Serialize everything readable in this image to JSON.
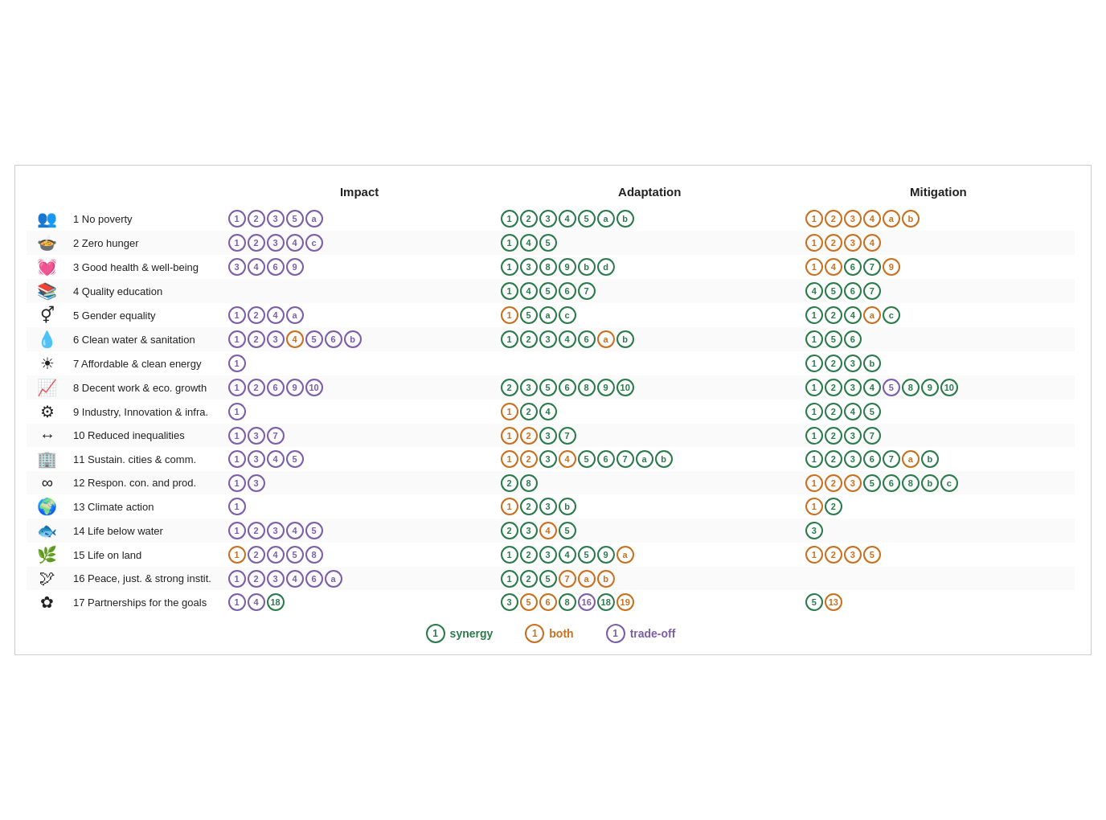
{
  "headers": {
    "icon": "",
    "sdg": "",
    "impact": "Impact",
    "adaptation": "Adaptation",
    "mitigation": "Mitigation"
  },
  "rows": [
    {
      "id": 1,
      "icon": "👨‍👩‍👧‍👦",
      "label": "1 No poverty",
      "impact": [
        {
          "v": "1",
          "t": "purple"
        },
        {
          "v": "2",
          "t": "purple"
        },
        {
          "v": "3",
          "t": "purple"
        },
        {
          "v": "5",
          "t": "purple"
        },
        {
          "v": "a",
          "t": "purple"
        }
      ],
      "adaptation": [
        {
          "v": "1",
          "t": "green"
        },
        {
          "v": "2",
          "t": "green"
        },
        {
          "v": "3",
          "t": "green"
        },
        {
          "v": "4",
          "t": "green"
        },
        {
          "v": "5",
          "t": "green"
        },
        {
          "v": "a",
          "t": "green"
        },
        {
          "v": "b",
          "t": "green"
        }
      ],
      "mitigation": [
        {
          "v": "1",
          "t": "orange"
        },
        {
          "v": "2",
          "t": "orange"
        },
        {
          "v": "3",
          "t": "orange"
        },
        {
          "v": "4",
          "t": "orange"
        },
        {
          "v": "a",
          "t": "orange"
        },
        {
          "v": "b",
          "t": "orange"
        }
      ]
    },
    {
      "id": 2,
      "icon": "🍚",
      "label": "2 Zero hunger",
      "impact": [
        {
          "v": "1",
          "t": "purple"
        },
        {
          "v": "2",
          "t": "purple"
        },
        {
          "v": "3",
          "t": "purple"
        },
        {
          "v": "4",
          "t": "purple"
        },
        {
          "v": "c",
          "t": "purple"
        }
      ],
      "adaptation": [
        {
          "v": "1",
          "t": "green"
        },
        {
          "v": "4",
          "t": "green"
        },
        {
          "v": "5",
          "t": "green"
        }
      ],
      "mitigation": [
        {
          "v": "1",
          "t": "orange"
        },
        {
          "v": "2",
          "t": "orange"
        },
        {
          "v": "3",
          "t": "orange"
        },
        {
          "v": "4",
          "t": "orange"
        }
      ]
    },
    {
      "id": 3,
      "icon": "💓",
      "label": "3 Good health & well-being",
      "impact": [
        {
          "v": "3",
          "t": "purple"
        },
        {
          "v": "4",
          "t": "purple"
        },
        {
          "v": "6",
          "t": "purple"
        },
        {
          "v": "9",
          "t": "purple"
        }
      ],
      "adaptation": [
        {
          "v": "1",
          "t": "green"
        },
        {
          "v": "3",
          "t": "green"
        },
        {
          "v": "8",
          "t": "green"
        },
        {
          "v": "9",
          "t": "green"
        },
        {
          "v": "b",
          "t": "green"
        },
        {
          "v": "d",
          "t": "green"
        }
      ],
      "mitigation": [
        {
          "v": "1",
          "t": "orange"
        },
        {
          "v": "4",
          "t": "orange"
        },
        {
          "v": "6",
          "t": "green"
        },
        {
          "v": "7",
          "t": "green"
        },
        {
          "v": "9",
          "t": "orange"
        }
      ]
    },
    {
      "id": 4,
      "icon": "📖",
      "label": "4 Quality education",
      "impact": [],
      "adaptation": [
        {
          "v": "1",
          "t": "green"
        },
        {
          "v": "4",
          "t": "green"
        },
        {
          "v": "5",
          "t": "green"
        },
        {
          "v": "6",
          "t": "green"
        },
        {
          "v": "7",
          "t": "green"
        }
      ],
      "mitigation": [
        {
          "v": "4",
          "t": "green"
        },
        {
          "v": "5",
          "t": "green"
        },
        {
          "v": "6",
          "t": "green"
        },
        {
          "v": "7",
          "t": "green"
        }
      ]
    },
    {
      "id": 5,
      "icon": "⚧",
      "label": "5 Gender equality",
      "impact": [
        {
          "v": "1",
          "t": "purple"
        },
        {
          "v": "2",
          "t": "purple"
        },
        {
          "v": "4",
          "t": "purple"
        },
        {
          "v": "a",
          "t": "purple"
        }
      ],
      "adaptation": [
        {
          "v": "1",
          "t": "orange"
        },
        {
          "v": "5",
          "t": "green"
        },
        {
          "v": "a",
          "t": "green"
        },
        {
          "v": "c",
          "t": "green"
        }
      ],
      "mitigation": [
        {
          "v": "1",
          "t": "green"
        },
        {
          "v": "2",
          "t": "green"
        },
        {
          "v": "4",
          "t": "green"
        },
        {
          "v": "a",
          "t": "orange"
        },
        {
          "v": "c",
          "t": "green"
        }
      ]
    },
    {
      "id": 6,
      "icon": "💧",
      "label": "6 Clean water & sanitation",
      "impact": [
        {
          "v": "1",
          "t": "purple"
        },
        {
          "v": "2",
          "t": "purple"
        },
        {
          "v": "3",
          "t": "purple"
        },
        {
          "v": "4",
          "t": "orange"
        },
        {
          "v": "5",
          "t": "purple"
        },
        {
          "v": "6",
          "t": "purple"
        },
        {
          "v": "b",
          "t": "purple"
        }
      ],
      "adaptation": [
        {
          "v": "1",
          "t": "green"
        },
        {
          "v": "2",
          "t": "green"
        },
        {
          "v": "3",
          "t": "green"
        },
        {
          "v": "4",
          "t": "green"
        },
        {
          "v": "6",
          "t": "green"
        },
        {
          "v": "a",
          "t": "orange"
        },
        {
          "v": "b",
          "t": "green"
        }
      ],
      "mitigation": [
        {
          "v": "1",
          "t": "green"
        },
        {
          "v": "5",
          "t": "green"
        },
        {
          "v": "6",
          "t": "green"
        }
      ]
    },
    {
      "id": 7,
      "icon": "☀",
      "label": "7 Affordable & clean energy",
      "impact": [
        {
          "v": "1",
          "t": "purple"
        }
      ],
      "adaptation": [],
      "mitigation": [
        {
          "v": "1",
          "t": "green"
        },
        {
          "v": "2",
          "t": "green"
        },
        {
          "v": "3",
          "t": "green"
        },
        {
          "v": "b",
          "t": "green"
        }
      ]
    },
    {
      "id": 8,
      "icon": "📊",
      "label": "8 Decent work & eco. growth",
      "impact": [
        {
          "v": "1",
          "t": "purple"
        },
        {
          "v": "2",
          "t": "purple"
        },
        {
          "v": "6",
          "t": "purple"
        },
        {
          "v": "9",
          "t": "purple"
        },
        {
          "v": "10",
          "t": "purple"
        }
      ],
      "adaptation": [
        {
          "v": "2",
          "t": "green"
        },
        {
          "v": "3",
          "t": "green"
        },
        {
          "v": "5",
          "t": "green"
        },
        {
          "v": "6",
          "t": "green"
        },
        {
          "v": "8",
          "t": "green"
        },
        {
          "v": "9",
          "t": "green"
        },
        {
          "v": "10",
          "t": "green"
        }
      ],
      "mitigation": [
        {
          "v": "1",
          "t": "green"
        },
        {
          "v": "2",
          "t": "green"
        },
        {
          "v": "3",
          "t": "green"
        },
        {
          "v": "4",
          "t": "green"
        },
        {
          "v": "5",
          "t": "purple"
        },
        {
          "v": "8",
          "t": "green"
        },
        {
          "v": "9",
          "t": "green"
        },
        {
          "v": "10",
          "t": "green"
        }
      ]
    },
    {
      "id": 9,
      "icon": "⚙",
      "label": "9 Industry, Innovation & infra.",
      "impact": [
        {
          "v": "1",
          "t": "purple"
        }
      ],
      "adaptation": [
        {
          "v": "1",
          "t": "orange"
        },
        {
          "v": "2",
          "t": "green"
        },
        {
          "v": "4",
          "t": "green"
        }
      ],
      "mitigation": [
        {
          "v": "1",
          "t": "green"
        },
        {
          "v": "2",
          "t": "green"
        },
        {
          "v": "4",
          "t": "green"
        },
        {
          "v": "5",
          "t": "green"
        }
      ]
    },
    {
      "id": 10,
      "icon": "⬅",
      "label": "10 Reduced inequalities",
      "impact": [
        {
          "v": "1",
          "t": "purple"
        },
        {
          "v": "3",
          "t": "purple"
        },
        {
          "v": "7",
          "t": "purple"
        }
      ],
      "adaptation": [
        {
          "v": "1",
          "t": "orange"
        },
        {
          "v": "2",
          "t": "orange"
        },
        {
          "v": "3",
          "t": "green"
        },
        {
          "v": "7",
          "t": "green"
        }
      ],
      "mitigation": [
        {
          "v": "1",
          "t": "green"
        },
        {
          "v": "2",
          "t": "green"
        },
        {
          "v": "3",
          "t": "green"
        },
        {
          "v": "7",
          "t": "green"
        }
      ]
    },
    {
      "id": 11,
      "icon": "🏙",
      "label": "11 Sustain. cities & comm.",
      "impact": [
        {
          "v": "1",
          "t": "purple"
        },
        {
          "v": "3",
          "t": "purple"
        },
        {
          "v": "4",
          "t": "purple"
        },
        {
          "v": "5",
          "t": "purple"
        }
      ],
      "adaptation": [
        {
          "v": "1",
          "t": "orange"
        },
        {
          "v": "2",
          "t": "orange"
        },
        {
          "v": "3",
          "t": "green"
        },
        {
          "v": "4",
          "t": "orange"
        },
        {
          "v": "5",
          "t": "green"
        },
        {
          "v": "6",
          "t": "green"
        },
        {
          "v": "7",
          "t": "green"
        },
        {
          "v": "a",
          "t": "green"
        },
        {
          "v": "b",
          "t": "green"
        }
      ],
      "mitigation": [
        {
          "v": "1",
          "t": "green"
        },
        {
          "v": "2",
          "t": "green"
        },
        {
          "v": "3",
          "t": "green"
        },
        {
          "v": "6",
          "t": "green"
        },
        {
          "v": "7",
          "t": "green"
        },
        {
          "v": "a",
          "t": "orange"
        },
        {
          "v": "b",
          "t": "green"
        }
      ]
    },
    {
      "id": 12,
      "icon": "∞",
      "label": "12 Respon. con. and prod.",
      "impact": [
        {
          "v": "1",
          "t": "purple"
        },
        {
          "v": "3",
          "t": "purple"
        }
      ],
      "adaptation": [
        {
          "v": "2",
          "t": "green"
        },
        {
          "v": "8",
          "t": "green"
        }
      ],
      "mitigation": [
        {
          "v": "1",
          "t": "orange"
        },
        {
          "v": "2",
          "t": "orange"
        },
        {
          "v": "3",
          "t": "orange"
        },
        {
          "v": "5",
          "t": "green"
        },
        {
          "v": "6",
          "t": "green"
        },
        {
          "v": "8",
          "t": "green"
        },
        {
          "v": "b",
          "t": "green"
        },
        {
          "v": "c",
          "t": "green"
        }
      ]
    },
    {
      "id": 13,
      "icon": "🌍",
      "label": "13 Climate action",
      "impact": [
        {
          "v": "1",
          "t": "purple"
        }
      ],
      "adaptation": [
        {
          "v": "1",
          "t": "orange"
        },
        {
          "v": "2",
          "t": "green"
        },
        {
          "v": "3",
          "t": "green"
        },
        {
          "v": "b",
          "t": "green"
        }
      ],
      "mitigation": [
        {
          "v": "1",
          "t": "orange"
        },
        {
          "v": "2",
          "t": "green"
        }
      ]
    },
    {
      "id": 14,
      "icon": "🐟",
      "label": "14 Life below water",
      "impact": [
        {
          "v": "1",
          "t": "purple"
        },
        {
          "v": "2",
          "t": "purple"
        },
        {
          "v": "3",
          "t": "purple"
        },
        {
          "v": "4",
          "t": "purple"
        },
        {
          "v": "5",
          "t": "purple"
        }
      ],
      "adaptation": [
        {
          "v": "2",
          "t": "green"
        },
        {
          "v": "3",
          "t": "green"
        },
        {
          "v": "4",
          "t": "orange"
        },
        {
          "v": "5",
          "t": "green"
        }
      ],
      "mitigation": [
        {
          "v": "3",
          "t": "green"
        }
      ]
    },
    {
      "id": 15,
      "icon": "🌿",
      "label": "15 Life on land",
      "impact": [
        {
          "v": "1",
          "t": "orange"
        },
        {
          "v": "2",
          "t": "purple"
        },
        {
          "v": "4",
          "t": "purple"
        },
        {
          "v": "5",
          "t": "purple"
        },
        {
          "v": "8",
          "t": "purple"
        }
      ],
      "adaptation": [
        {
          "v": "1",
          "t": "green"
        },
        {
          "v": "2",
          "t": "green"
        },
        {
          "v": "3",
          "t": "green"
        },
        {
          "v": "4",
          "t": "green"
        },
        {
          "v": "5",
          "t": "green"
        },
        {
          "v": "9",
          "t": "green"
        },
        {
          "v": "a",
          "t": "orange"
        }
      ],
      "mitigation": [
        {
          "v": "1",
          "t": "orange"
        },
        {
          "v": "2",
          "t": "orange"
        },
        {
          "v": "3",
          "t": "orange"
        },
        {
          "v": "5",
          "t": "orange"
        }
      ]
    },
    {
      "id": 16,
      "icon": "🕊",
      "label": "16 Peace, just. & strong instit.",
      "impact": [
        {
          "v": "1",
          "t": "purple"
        },
        {
          "v": "2",
          "t": "purple"
        },
        {
          "v": "3",
          "t": "purple"
        },
        {
          "v": "4",
          "t": "purple"
        },
        {
          "v": "6",
          "t": "purple"
        },
        {
          "v": "a",
          "t": "purple"
        }
      ],
      "adaptation": [
        {
          "v": "1",
          "t": "green"
        },
        {
          "v": "2",
          "t": "green"
        },
        {
          "v": "5",
          "t": "green"
        },
        {
          "v": "7",
          "t": "orange"
        },
        {
          "v": "a",
          "t": "orange"
        },
        {
          "v": "b",
          "t": "orange"
        }
      ],
      "mitigation": []
    },
    {
      "id": 17,
      "icon": "🌸",
      "label": "17 Partnerships for the goals",
      "impact": [
        {
          "v": "1",
          "t": "purple"
        },
        {
          "v": "4",
          "t": "purple"
        },
        {
          "v": "18",
          "t": "green"
        }
      ],
      "adaptation": [
        {
          "v": "3",
          "t": "green"
        },
        {
          "v": "5",
          "t": "orange"
        },
        {
          "v": "6",
          "t": "orange"
        },
        {
          "v": "8",
          "t": "green"
        },
        {
          "v": "16",
          "t": "purple"
        },
        {
          "v": "18",
          "t": "green"
        },
        {
          "v": "19",
          "t": "orange"
        }
      ],
      "mitigation": [
        {
          "v": "5",
          "t": "green"
        },
        {
          "v": "13",
          "t": "orange"
        }
      ]
    }
  ],
  "legend": {
    "synergy": "synergy",
    "both": "both",
    "tradeoff": "trade-off",
    "synergy_num": "1",
    "both_num": "1",
    "tradeoff_num": "1"
  },
  "icons": {
    "1": "👥",
    "2": "🍲",
    "3": "❤",
    "4": "📚",
    "5": "⚥",
    "6": "💧",
    "7": "☀",
    "8": "📈",
    "9": "🔩",
    "10": "↔",
    "11": "🏢",
    "12": "♾",
    "13": "🌍",
    "14": "🐠",
    "15": "🌱",
    "16": "🕊",
    "17": "🌐"
  }
}
